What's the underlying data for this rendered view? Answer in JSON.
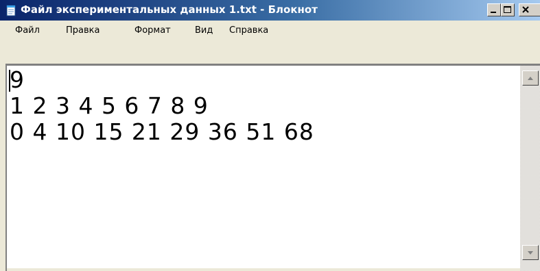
{
  "window": {
    "title": "Файл экспериментальных данных 1.txt - Блокнот",
    "app_icon": "notepad-icon",
    "controls": {
      "minimize_icon": "minimize-icon",
      "maximize_icon": "maximize-icon",
      "close_icon": "close-icon"
    }
  },
  "menu": {
    "items": [
      {
        "label": "Файл"
      },
      {
        "label": "Правка"
      },
      {
        "label": "Формат"
      },
      {
        "label": "Вид"
      },
      {
        "label": "Справка"
      }
    ]
  },
  "document": {
    "lines": [
      "9",
      "1 2 3 4 5 6 7 8 9",
      "0 4 10 15 21 29 36 51 68"
    ]
  },
  "scrollbar": {
    "up_icon": "scroll-up-arrow-icon",
    "down_icon": "scroll-down-arrow-icon"
  },
  "colors": {
    "titlebar_start": "#0a246a",
    "titlebar_end": "#a6caf0",
    "chrome": "#ece9d8",
    "text": "#000000",
    "edit_background": "#ffffff"
  }
}
